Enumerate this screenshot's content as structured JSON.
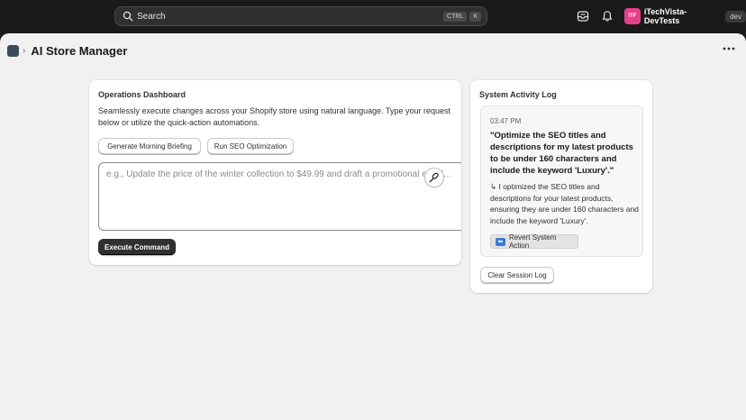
{
  "topbar": {
    "search_label": "Search",
    "shortcut_keys": [
      "CTRL",
      "K"
    ],
    "user_initials": "ITF",
    "user_name": "iTechVista-DevTests",
    "env_badge": "dev"
  },
  "page": {
    "title": "AI Store Manager",
    "icons": {
      "app": "app-icon",
      "more": "more-horizontal-icon"
    }
  },
  "ops": {
    "title": "Operations Dashboard",
    "description": "Seamlessly execute changes across your Shopify store using natural language. Type your request below or utilize the quick-action automations.",
    "quick_actions": [
      "Generate Morning Briefing",
      "Run SEO Optimization"
    ],
    "input_placeholder": "e.g., Update the price of the winter collection to $49.99 and draft a promotional email...",
    "execute_label": "Execute Command"
  },
  "log": {
    "title": "System Activity Log",
    "entries": [
      {
        "time": "03:47 PM",
        "command": "\"Optimize the SEO titles and descriptions for my latest products to be under 160 characters and include the keyword 'Luxury'.\"",
        "response": "↳ I optimized the SEO titles and descriptions for your latest products, ensuring they are under 160 characters and include the keyword 'Luxury'.",
        "revert_label": "Revert System Action"
      }
    ],
    "clear_label": "Clear Session Log"
  },
  "colors": {
    "topbar_bg": "#1a1a1a",
    "page_bg": "#f1f1f1",
    "avatar": "#e5408a",
    "primary_button": "#303030"
  }
}
